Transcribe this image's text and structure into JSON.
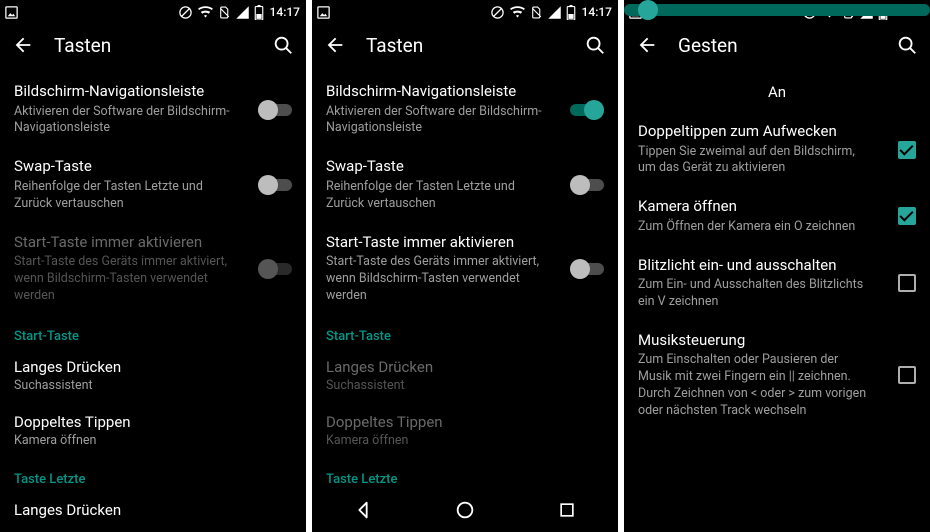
{
  "status": {
    "time": "14:17"
  },
  "accent": "#26a69a",
  "screens": [
    {
      "key": "tasten-off",
      "title": "Tasten",
      "navrail": false,
      "content": [
        {
          "type": "toggle",
          "key": "navleiste",
          "title": "Bildschirm-Navigationsleiste",
          "subtitle": "Aktivieren der Software der Bildschirm-Navigationsleiste",
          "on": false,
          "disabled": false
        },
        {
          "type": "toggle",
          "key": "swap",
          "title": "Swap-Taste",
          "subtitle": "Reihenfolge der Tasten Letzte und Zurück vertauschen",
          "on": false,
          "disabled": false
        },
        {
          "type": "toggle",
          "key": "startimmer",
          "title": "Start-Taste immer aktivieren",
          "subtitle": "Start-Taste des Geräts immer aktiviert, wenn Bildschirm-Tasten verwendet werden",
          "on": false,
          "disabled": true
        },
        {
          "type": "category",
          "key": "cat-start",
          "label": "Start-Taste"
        },
        {
          "type": "link",
          "key": "langes",
          "title": "Langes Drücken",
          "subtitle": "Suchassistent",
          "disabled": false
        },
        {
          "type": "link",
          "key": "doppel",
          "title": "Doppeltes Tippen",
          "subtitle": "Kamera öffnen",
          "disabled": false
        },
        {
          "type": "category",
          "key": "cat-letzte",
          "label": "Taste Letzte"
        },
        {
          "type": "link",
          "key": "langes2",
          "title": "Langes Drücken",
          "subtitle": "",
          "disabled": false
        }
      ]
    },
    {
      "key": "tasten-on",
      "title": "Tasten",
      "navrail": true,
      "content": [
        {
          "type": "toggle",
          "key": "navleiste",
          "title": "Bildschirm-Navigationsleiste",
          "subtitle": "Aktivieren der Software der Bildschirm-Navigationsleiste",
          "on": true,
          "disabled": false
        },
        {
          "type": "toggle",
          "key": "swap",
          "title": "Swap-Taste",
          "subtitle": "Reihenfolge der Tasten Letzte und Zurück vertauschen",
          "on": false,
          "disabled": false
        },
        {
          "type": "toggle",
          "key": "startimmer",
          "title": "Start-Taste immer aktivieren",
          "subtitle": "Start-Taste des Geräts immer aktiviert, wenn Bildschirm-Tasten verwendet werden",
          "on": false,
          "disabled": false
        },
        {
          "type": "category",
          "key": "cat-start",
          "label": "Start-Taste"
        },
        {
          "type": "link",
          "key": "langes",
          "title": "Langes Drücken",
          "subtitle": "Suchassistent",
          "disabled": true
        },
        {
          "type": "link",
          "key": "doppel",
          "title": "Doppeltes Tippen",
          "subtitle": "Kamera öffnen",
          "disabled": true
        },
        {
          "type": "category",
          "key": "cat-letzte",
          "label": "Taste Letzte"
        }
      ]
    },
    {
      "key": "gesten",
      "title": "Gesten",
      "navrail": false,
      "content": [
        {
          "type": "master",
          "key": "an",
          "label": "An",
          "on": true
        },
        {
          "type": "check",
          "key": "doppeltippen",
          "title": "Doppeltippen zum Aufwecken",
          "subtitle": "Tippen Sie zweimal auf den Bildschirm, um das Gerät zu aktivieren",
          "checked": true
        },
        {
          "type": "check",
          "key": "kamera",
          "title": "Kamera öffnen",
          "subtitle": "Zum Öffnen der Kamera ein O zeichnen",
          "checked": true
        },
        {
          "type": "check",
          "key": "blitz",
          "title": "Blitzlicht ein- und ausschalten",
          "subtitle": "Zum Ein- und Ausschalten des Blitzlichts ein V zeichnen",
          "checked": false
        },
        {
          "type": "check",
          "key": "musik",
          "title": "Musiksteuerung",
          "subtitle": "Zum Einschalten oder Pausieren der Musik mit zwei Fingern ein || zeichnen. Durch Zeichnen von < oder > zum vorigen oder nächsten Track wechseln",
          "checked": false
        }
      ]
    }
  ]
}
